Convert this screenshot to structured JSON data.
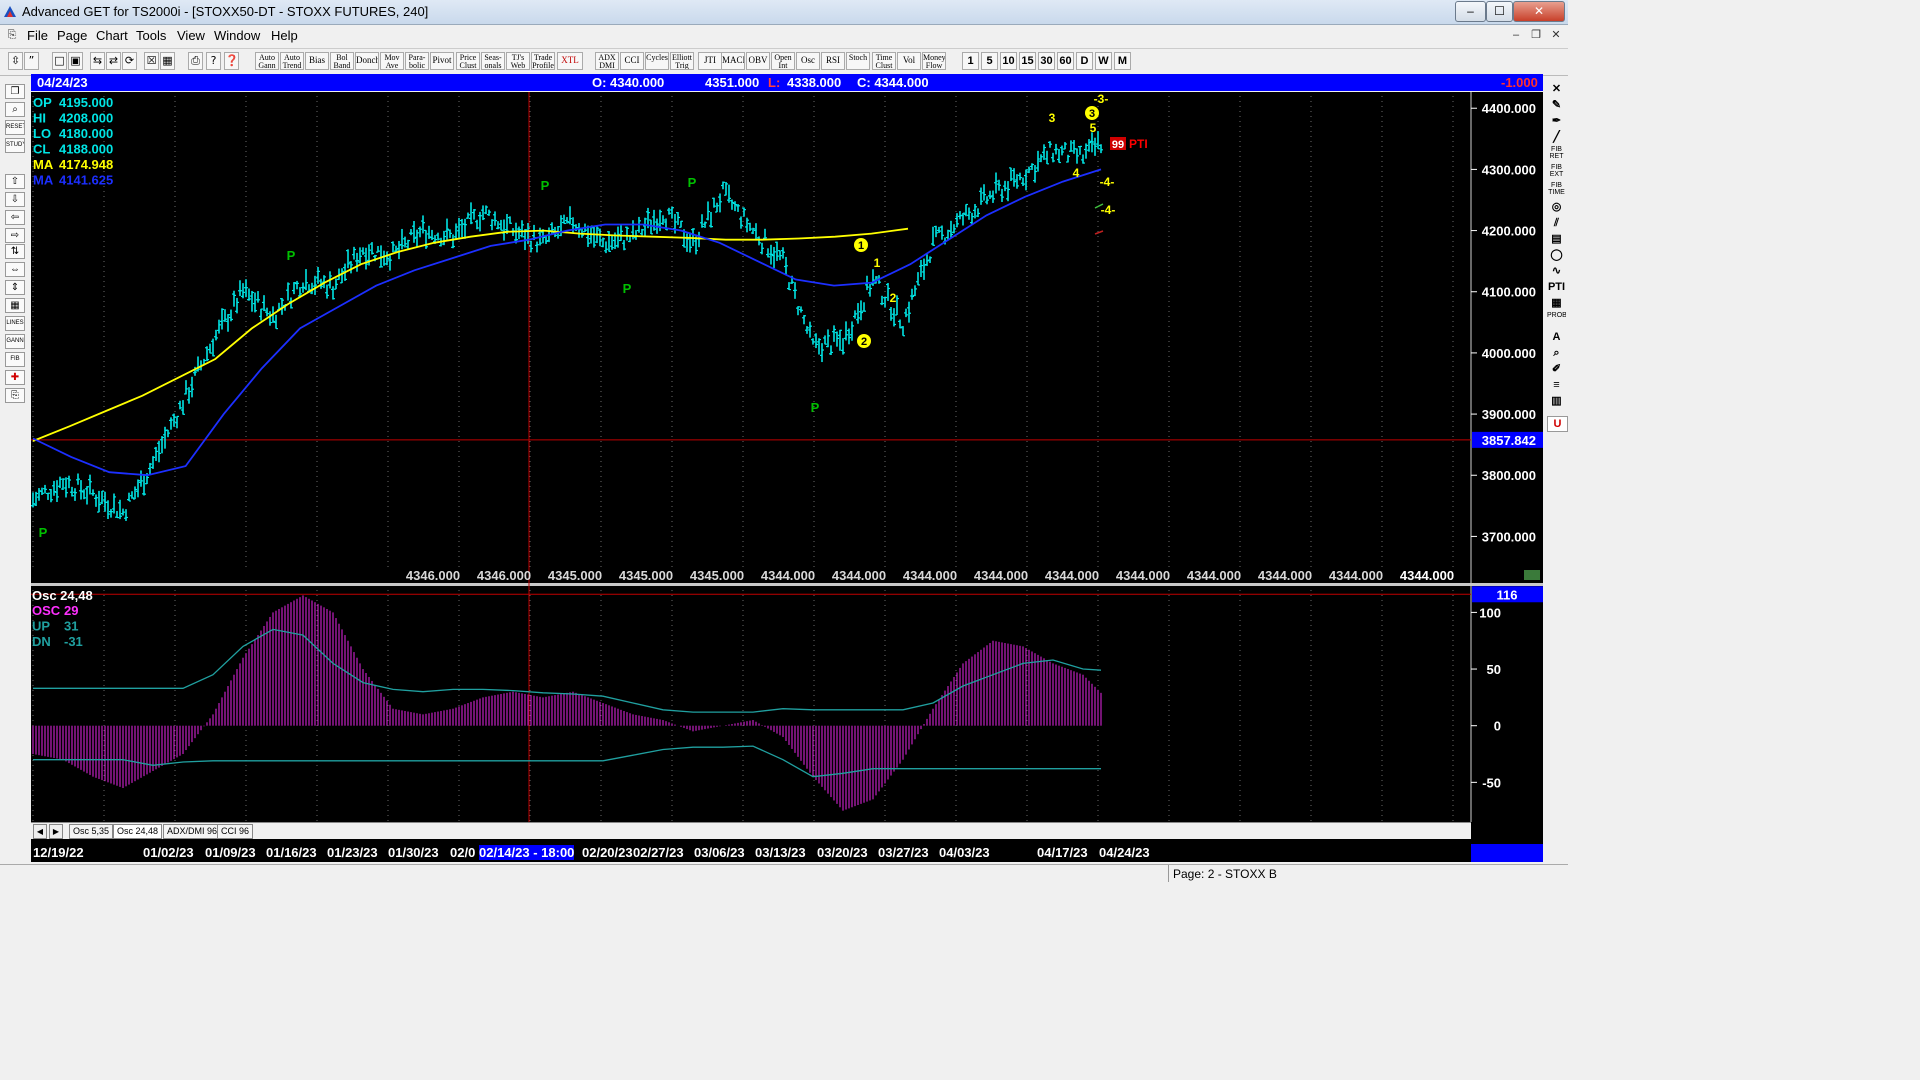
{
  "window": {
    "title": "Advanced GET for TS2000i - [STOXX50-DT - STOXX FUTURES, 240]",
    "minimize": "–",
    "maximize": "☐",
    "close": "✕"
  },
  "menu": [
    "File",
    "Page",
    "Chart",
    "Tools",
    "View",
    "Window",
    "Help"
  ],
  "toolbar": {
    "studies": [
      "Auto Gann",
      "Auto Trend",
      "Bias",
      "Bol Band",
      "Donch",
      "Mov Ave",
      "Para-bolic",
      "Pivot",
      "Price Clust",
      "Seas-onals",
      "TJ's Web",
      "Trade Profile",
      "XTL",
      "ADX DMI",
      "CCI",
      "Cycles",
      "Elliott Trig",
      "JTI",
      "MACD",
      "OBV",
      "Open Int",
      "Osc",
      "RSI",
      "Stoch",
      "Time Clust",
      "Vol",
      "Money Flow"
    ],
    "periods": [
      "1",
      "5",
      "10",
      "15",
      "30",
      "60",
      "D",
      "W",
      "M"
    ]
  },
  "infobar": {
    "date": "04/24/23",
    "open": "O: 4340.000",
    "high": "4351.000",
    "low_label": "L:",
    "low": "4338.000",
    "close": "C: 4344.000",
    "change": "-1.000"
  },
  "price_panel": {
    "readout": [
      {
        "label": "OP",
        "value": "4195.000"
      },
      {
        "label": "HI",
        "value": "4208.000"
      },
      {
        "label": "LO",
        "value": "4180.000"
      },
      {
        "label": "CL",
        "value": "4188.000"
      },
      {
        "label": "MA",
        "value": "4174.948"
      },
      {
        "label": "MA",
        "value": "4141.625"
      }
    ],
    "y_ticks": [
      "4400.000",
      "4300.000",
      "4200.000",
      "4100.000",
      "4000.000",
      "3900.000",
      "3800.000",
      "3700.000"
    ],
    "ylim": [
      3650,
      4420
    ],
    "cursor_price": "3857.842",
    "bottom_values": [
      "4346.000",
      "4346.000",
      "4345.000",
      "4345.000",
      "4345.000",
      "4344.000",
      "4344.000",
      "4344.000",
      "4344.000",
      "4344.000",
      "4344.000",
      "4344.000",
      "4344.000",
      "4344.000"
    ],
    "last_value": "4344.000",
    "pivot_labels": [
      "P",
      "P",
      "P",
      "P",
      "P",
      "P"
    ],
    "wave_numbers": [
      "1",
      "2",
      "3"
    ],
    "wave_labels": [
      "1",
      "2",
      "3",
      "5",
      "4",
      "-3-",
      "-4-",
      "-4-"
    ],
    "pti": {
      "value": "99",
      "label": "PTI"
    },
    "colors": {
      "price": "#00e5e5",
      "ma_fast": "#ffff00",
      "ma_slow": "#1c2fff",
      "pivot": "#00c000",
      "wave": "#ffff00",
      "pti": "#ff0000"
    }
  },
  "osc_panel": {
    "title": "Osc 24,48",
    "readout": [
      {
        "label": "OSC",
        "value": "29"
      },
      {
        "label": "UP",
        "value": "31"
      },
      {
        "label": "DN",
        "value": "-31"
      }
    ],
    "y_ticks": [
      "100",
      "50",
      "0",
      "-50"
    ],
    "ylim": [
      -85,
      118
    ],
    "marker": "116",
    "colors": {
      "hist": "#c020c0",
      "band": "#20a0a0"
    }
  },
  "tabs": [
    "Osc 5,35",
    "Osc 24,48",
    "ADX/DMI 96",
    "CCI 96"
  ],
  "tab_nav": [
    "◀",
    "▶"
  ],
  "dates": [
    "12/19/22",
    "01/02/23",
    "01/09/23",
    "01/16/23",
    "01/23/23",
    "01/30/23",
    "02/0",
    "02/14/23 - 18:00",
    "02/20/23",
    "02/27/23",
    "03/06/23",
    "03/13/23",
    "03/20/23",
    "03/27/23",
    "04/03/23",
    "04/17/23",
    "04/24/23"
  ],
  "status": {
    "page": "Page: 2 - STOXX B"
  },
  "chart_data": {
    "type": "bar",
    "title": "STOXX50-DT - STOXX FUTURES, 240",
    "x": [
      0,
      30,
      60,
      90,
      120,
      150,
      180,
      210,
      240,
      270,
      300,
      330,
      360,
      390,
      420,
      450,
      480,
      510,
      540,
      570,
      600,
      630,
      660,
      690,
      720,
      750,
      780,
      810,
      840,
      870,
      900,
      930,
      960,
      990,
      1020,
      1050,
      1068
    ],
    "close": [
      3760,
      3790,
      3770,
      3740,
      3820,
      3920,
      4020,
      4100,
      4060,
      4120,
      4110,
      4170,
      4160,
      4200,
      4190,
      4230,
      4200,
      4180,
      4215,
      4180,
      4190,
      4230,
      4180,
      4260,
      4200,
      4150,
      4010,
      4020,
      4120,
      4050,
      4180,
      4220,
      4260,
      4290,
      4330,
      4320,
      4344
    ],
    "ma_fast": [
      3856,
      3880,
      3905,
      3930,
      3960,
      3990,
      4040,
      4080,
      4115,
      4145,
      4165,
      4180,
      4190,
      4198,
      4200,
      4195,
      4192,
      4190,
      4188,
      4185,
      4185,
      4187,
      4190,
      4195,
      4203
    ],
    "ma_slow": [
      3860,
      3830,
      3805,
      3800,
      3815,
      3900,
      3975,
      4040,
      4075,
      4110,
      4135,
      4155,
      4175,
      4185,
      4200,
      4210,
      4210,
      4200,
      4180,
      4150,
      4120,
      4110,
      4115,
      4145,
      4185,
      4225,
      4255,
      4280,
      4300
    ],
    "osc": [
      -25,
      -30,
      -45,
      -55,
      -40,
      -25,
      10,
      60,
      100,
      115,
      100,
      50,
      15,
      10,
      15,
      25,
      30,
      25,
      30,
      20,
      10,
      5,
      -5,
      0,
      5,
      -10,
      -45,
      -75,
      -65,
      -30,
      15,
      55,
      75,
      70,
      55,
      45,
      29
    ],
    "osc_up": [
      33,
      33,
      33,
      33,
      33,
      33,
      45,
      70,
      85,
      80,
      55,
      38,
      32,
      30,
      32,
      32,
      31,
      29,
      28,
      26,
      20,
      14,
      12,
      12,
      12,
      15,
      14,
      14,
      14,
      14,
      20,
      35,
      45,
      55,
      58,
      50,
      49
    ],
    "osc_dn": [
      -30,
      -30,
      -30,
      -30,
      -35,
      -32,
      -31,
      -31,
      -31,
      -31,
      -31,
      -31,
      -31,
      -31,
      -31,
      -31,
      -31,
      -31,
      -31,
      -31,
      -26,
      -21,
      -19,
      -19,
      -18,
      -30,
      -45,
      -42,
      -38,
      -38,
      -38,
      -38,
      -38,
      -38,
      -38,
      -38,
      -38
    ]
  }
}
